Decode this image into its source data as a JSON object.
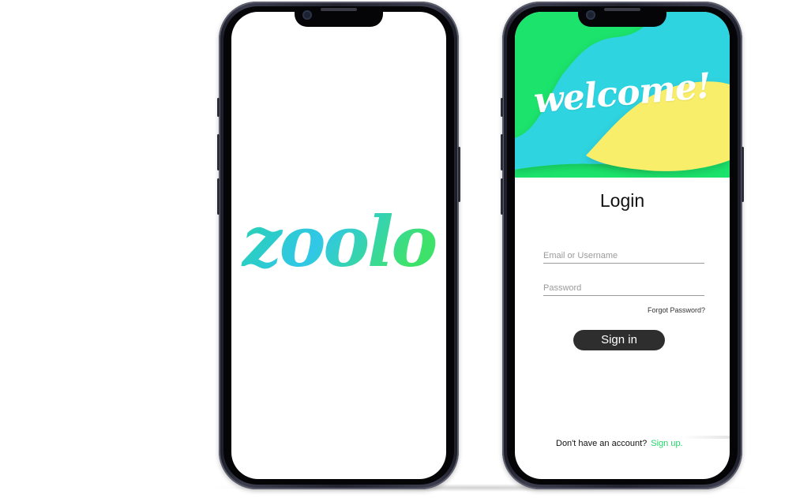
{
  "splash": {
    "logo_text": "zoolo",
    "logo_gradient": [
      "#27d3a8",
      "#30c7e8",
      "#3ee26b"
    ]
  },
  "login_screen": {
    "welcome_text": "welcome!",
    "title": "Login",
    "email_placeholder": "Email or Username",
    "password_placeholder": "Password",
    "forgot_label": "Forgot Password?",
    "signin_label": "Sign in",
    "no_account_text": "Don't have an account?",
    "signup_label": "Sign up.",
    "colors": {
      "green": "#1be36b",
      "cyan": "#2ed4e0",
      "yellow": "#f8ee6a",
      "button": "#2e2e2e",
      "link": "#22d46a"
    }
  }
}
